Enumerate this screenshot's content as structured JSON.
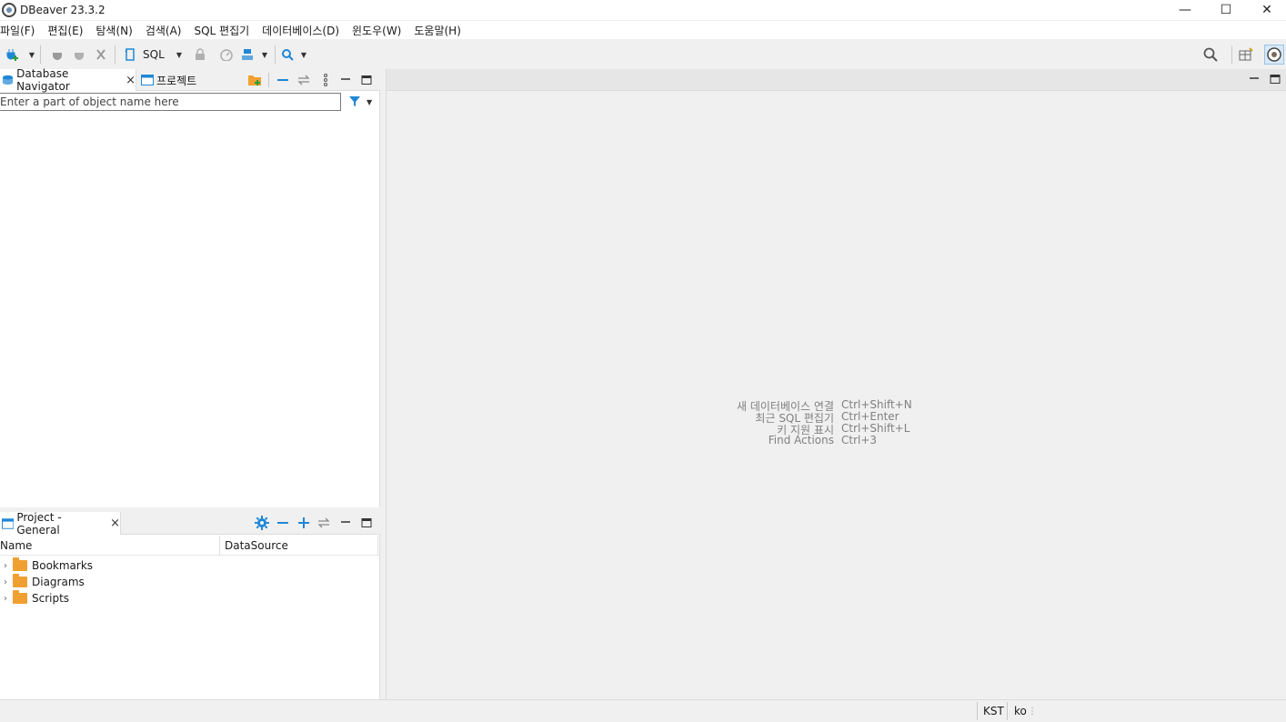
{
  "window": {
    "title": "DBeaver 23.3.2",
    "buttons": {
      "minimize": "—",
      "maximize": "☐",
      "close": "✕"
    }
  },
  "menu": [
    "파일(F)",
    "편집(E)",
    "탐색(N)",
    "검색(A)",
    "SQL 편집기",
    "데이터베이스(D)",
    "윈도우(W)",
    "도움말(H)"
  ],
  "toolbar": {
    "sql_label": "SQL",
    "icons": [
      "new-connection-icon",
      "connect-icon",
      "disconnect-icon",
      "invalidate-icon",
      "sql-editor-icon",
      "lock-icon",
      "dashboard-icon",
      "transaction-icon",
      "search-icon",
      "global-search-icon",
      "perspective-icon",
      "dbeaver-perspective-icon"
    ]
  },
  "navigator": {
    "tabs": [
      {
        "label": "Database Navigator",
        "close": "×"
      },
      {
        "label": "프로젝트"
      }
    ],
    "search_placeholder": "Enter a part of object name here",
    "search_value": ""
  },
  "project_panel": {
    "tab_label": "Project - General",
    "tab_close": "×",
    "columns": [
      "Name",
      "DataSource"
    ],
    "items": [
      {
        "label": "Bookmarks",
        "datasource": ""
      },
      {
        "label": "Diagrams",
        "datasource": ""
      },
      {
        "label": "Scripts",
        "datasource": ""
      }
    ]
  },
  "editor_hints": [
    {
      "action": "새 데이터베이스 연결",
      "shortcut": "Ctrl+Shift+N"
    },
    {
      "action": "최근 SQL 편집기",
      "shortcut": "Ctrl+Enter"
    },
    {
      "action": "키 지원 표시",
      "shortcut": "Ctrl+Shift+L"
    },
    {
      "action": "Find Actions",
      "shortcut": "Ctrl+3"
    }
  ],
  "status": {
    "timezone": "KST",
    "locale": "ko"
  },
  "colors": {
    "accent": "#1f87d6",
    "folder": "#f0a030",
    "hint_text": "#808080"
  }
}
